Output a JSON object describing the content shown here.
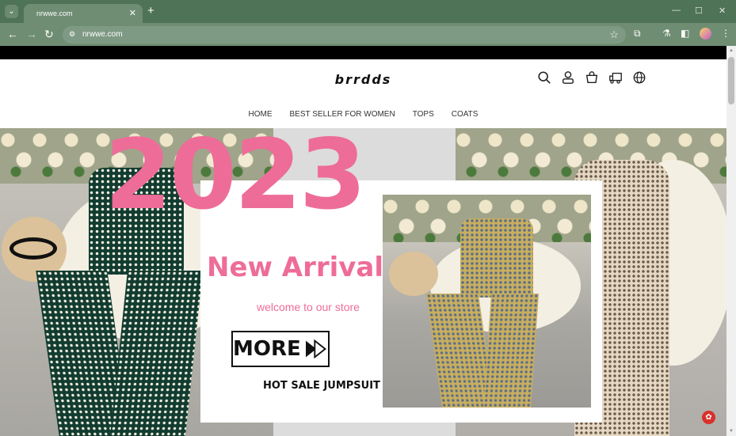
{
  "browser": {
    "tab_title": "nrwwe.com",
    "tab_close": "✕",
    "new_tab": "+",
    "url": "nrwwe.com",
    "window_controls": {
      "minimize": "—",
      "maximize": "☐",
      "close": "✕"
    },
    "nav": {
      "back": "←",
      "forward": "→",
      "reload": "↻"
    }
  },
  "site": {
    "logo": "brrdds",
    "nav_menu": [
      "HOME",
      "BEST SELLER FOR WOMEN",
      "TOPS",
      "COATS"
    ],
    "header_icons": [
      "search-icon",
      "account-icon",
      "cart-icon",
      "shipping-truck-icon",
      "globe-icon"
    ]
  },
  "hero": {
    "year": "2023",
    "headline": "New Arrival",
    "subline": "welcome to our store",
    "button_label": "MORE",
    "caption": "HOT SALE JUMPSUIT"
  },
  "colors": {
    "browser_frame": "#4f7357",
    "toolbar": "#6f8d73",
    "accent_pink": "#ee6c98",
    "chat_red": "#d9302a"
  }
}
